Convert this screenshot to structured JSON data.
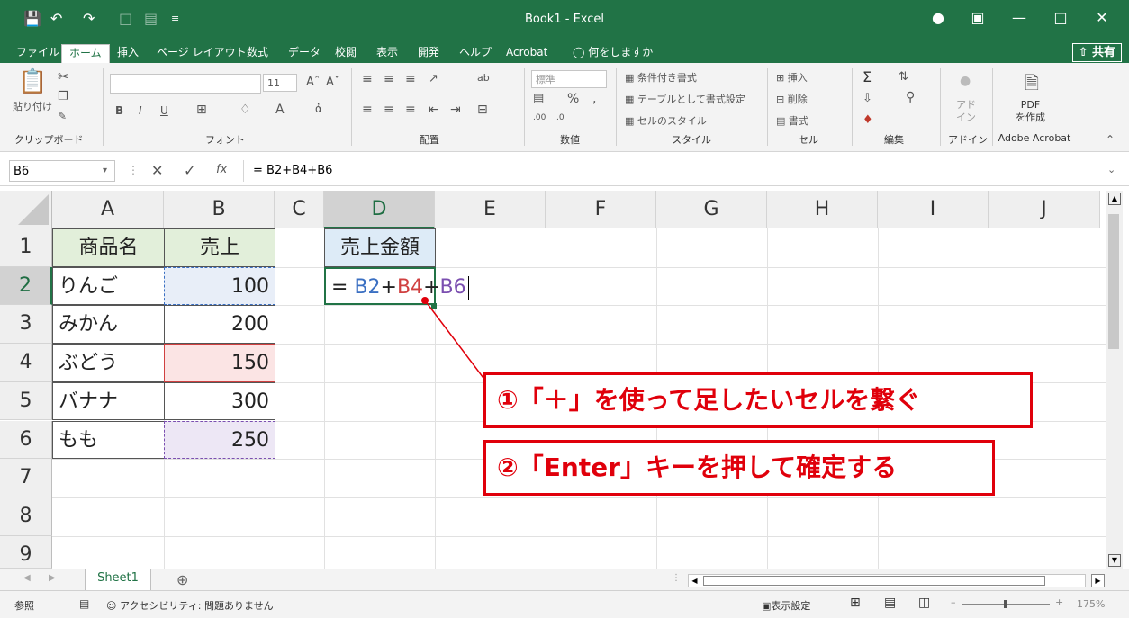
{
  "window": {
    "title": "Book1  -  Excel",
    "qa_icons": [
      "save-icon",
      "undo-icon",
      "redo-icon",
      "new-icon",
      "form-icon",
      "customize-icon"
    ],
    "controls": [
      "account-icon",
      "ribbon-display-icon",
      "minimize-icon",
      "maximize-icon",
      "close-icon"
    ]
  },
  "menu": {
    "items": [
      "ファイル",
      "ホーム",
      "挿入",
      "ページ レイアウト",
      "数式",
      "データ",
      "校閲",
      "表示",
      "開発",
      "ヘルプ",
      "Acrobat"
    ],
    "active": "ホーム",
    "search": "何をしますか",
    "share": "共有"
  },
  "ribbon": {
    "groups": [
      "クリップボード",
      "フォント",
      "配置",
      "数値",
      "スタイル",
      "セル",
      "編集",
      "アドイン",
      "Adobe Acrobat"
    ],
    "clipboard": {
      "paste": "貼り付け"
    },
    "font": {
      "size": "11",
      "bold": "B",
      "italic": "I",
      "underline": "U"
    },
    "number": {
      "format": "標準",
      "percent": "%",
      "comma": ","
    },
    "styles": {
      "conditional": "条件付き書式",
      "table": "テーブルとして書式設定",
      "cell_styles": "セルのスタイル"
    },
    "cells": {
      "insert": "挿入",
      "delete": "削除",
      "format": "書式"
    },
    "editing": {
      "sum": "Σ"
    },
    "addin": {
      "label": "アド\nイン"
    },
    "acrobat": {
      "label": "PDF\nを作成"
    }
  },
  "formula_bar": {
    "name_box": "B6",
    "cancel": "✕",
    "enter": "✓",
    "fx": "fx",
    "formula": "= B2+B4+B6"
  },
  "columns": [
    "A",
    "B",
    "C",
    "D",
    "E",
    "F",
    "G",
    "H",
    "I",
    "J"
  ],
  "rows": [
    "1",
    "2",
    "3",
    "4",
    "5",
    "6",
    "7",
    "8",
    "9"
  ],
  "table": {
    "header_name": "商品名",
    "header_sales": "売上",
    "items": [
      {
        "name": "りんご",
        "sales": "100"
      },
      {
        "name": "みかん",
        "sales": "200"
      },
      {
        "name": "ぶどう",
        "sales": "150"
      },
      {
        "name": "バナナ",
        "sales": "300"
      },
      {
        "name": "もも",
        "sales": "250"
      }
    ]
  },
  "result": {
    "header": "売上金額",
    "formula_parts": [
      "= ",
      "B2",
      "+",
      "B4",
      "+",
      "B6"
    ],
    "colors": {
      "b2": "#3a6fc2",
      "b4": "#d04040",
      "b6": "#7b4fb0"
    }
  },
  "callouts": {
    "step1": "①「＋」を使って足したいセルを繋ぐ",
    "step2": "②「Enter」キーを押して確定する",
    "color": "#e0000b"
  },
  "sheet": {
    "tab": "Sheet1",
    "add": "⊕"
  },
  "status": {
    "mode": "参照",
    "accessibility": "アクセシビリティ: 問題ありません",
    "display_settings": "表示設定",
    "zoom": "175%"
  }
}
